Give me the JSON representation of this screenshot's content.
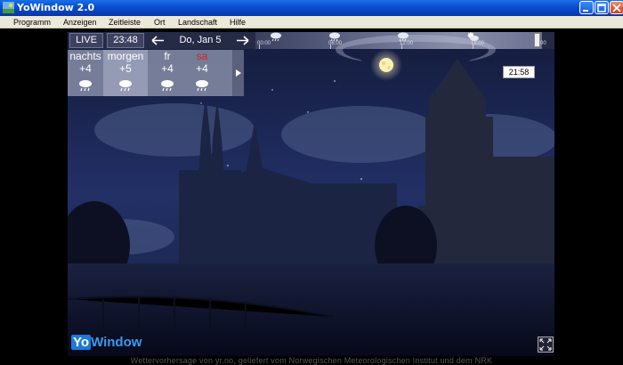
{
  "window": {
    "title": "YoWindow 2.0"
  },
  "menu": {
    "items": [
      "Programm",
      "Anzeigen",
      "Zeitleiste",
      "Ort",
      "Landschaft",
      "Hilfe"
    ]
  },
  "timebar": {
    "live_label": "LIVE",
    "clock": "23:48",
    "date": "Do, Jan 5",
    "timeline_labels": [
      "00:00",
      "06:00",
      "12:00",
      "18:00",
      "00"
    ]
  },
  "forecast": {
    "days": [
      {
        "name": "nachts",
        "temp": "+4",
        "icon": "cloud-rain-icon",
        "weekend": false
      },
      {
        "name": "morgen",
        "temp": "+5",
        "icon": "cloud-rain-icon",
        "weekend": false
      },
      {
        "name": "fr",
        "temp": "+4",
        "icon": "cloud-rain-icon",
        "weekend": false
      },
      {
        "name": "sa",
        "temp": "+4",
        "icon": "cloud-rain-icon",
        "weekend": true
      }
    ]
  },
  "time_tag": "21:58",
  "logo": {
    "yo": "Yo",
    "window": "Window"
  },
  "footer": "Wettervorhersage von yr.no, geliefert vom Norwegischen Meteorologischen Institut und dem NRK",
  "colors": {
    "titlebar": "#0a4bd0",
    "weekend_red": "#d82020",
    "sky_night": "#1a2550"
  }
}
